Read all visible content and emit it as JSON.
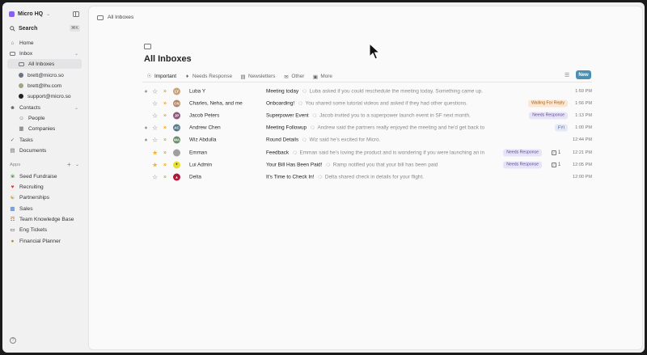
{
  "sidebar": {
    "workspace": "Micro HQ",
    "search_label": "Search",
    "search_kbd": "⌘K",
    "home": "Home",
    "inbox": "Inbox",
    "inbox_items": [
      "All Inboxes",
      "brett@micro.so",
      "brett@lhv.com",
      "support@micro.so"
    ],
    "contacts": "Contacts",
    "contact_items": [
      "People",
      "Companies"
    ],
    "tasks": "Tasks",
    "documents": "Documents",
    "apps_header": "Apps",
    "apps": [
      {
        "label": "Seed Fundraise",
        "icon": "seedling-icon"
      },
      {
        "label": "Recruiting",
        "icon": "heart-icon"
      },
      {
        "label": "Partnerships",
        "icon": "handshake-icon"
      },
      {
        "label": "Sales",
        "icon": "chart-icon"
      },
      {
        "label": "Team Knowledge Base",
        "icon": "book-icon"
      },
      {
        "label": "Eng Tickets",
        "icon": "monitor-icon"
      },
      {
        "label": "Financial Planner",
        "icon": "money-bag-icon"
      }
    ]
  },
  "main": {
    "breadcrumb": "All Inboxes",
    "title": "All Inboxes",
    "tabs": [
      "Important",
      "Needs Response",
      "Newsletters",
      "Other",
      "More"
    ],
    "new_button": "New",
    "rows": [
      {
        "sender": "Luba Y",
        "subject": "Meeting today",
        "preview": "Luba asked if you could reschedule the meeting today. Something came up.",
        "time": "1:59 PM",
        "unread": true,
        "starred": false,
        "badge": "",
        "tasks": ""
      },
      {
        "sender": "Charles, Neha, and me",
        "subject": "Onboarding!",
        "preview": "You shared some tutorial videos and asked if they had other questions.",
        "time": "1:56 PM",
        "unread": false,
        "starred": false,
        "badge": "Waiting For Reply",
        "badge_type": "wait",
        "tasks": ""
      },
      {
        "sender": "Jacob Peters",
        "subject": "Superpower Event",
        "preview": "Jacob invited you to a superpower launch event in SF next month.",
        "time": "1:13 PM",
        "unread": false,
        "starred": false,
        "badge": "Needs Response",
        "badge_type": "need",
        "tasks": ""
      },
      {
        "sender": "Andrew Chen",
        "subject": "Meeting Followup",
        "preview": "Andrew said the partners really enjoyed the meeting and he'd get back to...",
        "time": "1:00 PM",
        "unread": true,
        "starred": false,
        "badge": "FYI",
        "badge_type": "fyi",
        "tasks": ""
      },
      {
        "sender": "Wiz Abdulla",
        "subject": "Round Details",
        "preview": "Wiz said he's excited for Micro.",
        "time": "12:44 PM",
        "unread": true,
        "starred": false,
        "badge": "",
        "tasks": ""
      },
      {
        "sender": "Emman",
        "subject": "Feedback",
        "preview": "Emman said he's loving the product and is wondering if you were launching an inte",
        "time": "12:21 PM",
        "unread": false,
        "starred": true,
        "badge": "Needs Response",
        "badge_type": "need",
        "tasks": "1"
      },
      {
        "sender": "Lui Admin",
        "subject": "Your Bill Has Been Paid!",
        "preview": "Ramp notified you that your bill has been paid",
        "time": "12:05 PM",
        "unread": false,
        "starred": true,
        "badge": "Needs Response",
        "badge_type": "need",
        "tasks": "1"
      },
      {
        "sender": "Delta",
        "subject": "It's Time to Check In!",
        "preview": "Delta shared check in details for your flight.",
        "time": "12:00 PM",
        "unread": false,
        "starred": false,
        "badge": "",
        "tasks": ""
      }
    ]
  },
  "colors": {
    "accent": "#4b8fb3",
    "needs_response": "#e8e4f8",
    "waiting": "#fbe7d2",
    "star": "#f0b429"
  }
}
